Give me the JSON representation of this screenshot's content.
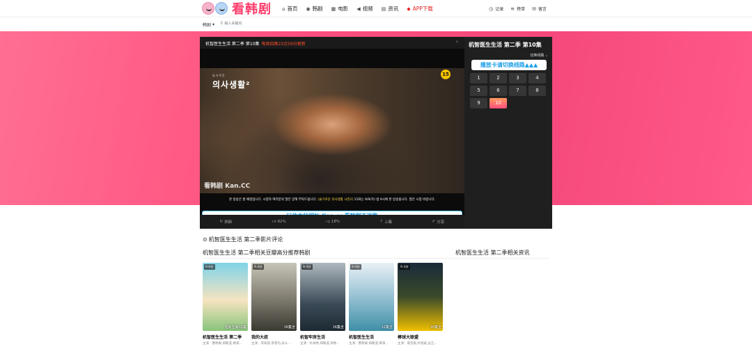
{
  "header": {
    "logo_text": "看韩剧",
    "nav": [
      {
        "label": "首页",
        "icon": "home-icon"
      },
      {
        "label": "韩剧",
        "icon": "tv-icon"
      },
      {
        "label": "电影",
        "icon": "film-icon"
      },
      {
        "label": "视频",
        "icon": "play-icon"
      },
      {
        "label": "资讯",
        "icon": "news-icon"
      },
      {
        "label": "APP下载",
        "icon": "app-icon"
      }
    ],
    "right": [
      {
        "label": "记录",
        "icon": "history-icon"
      },
      {
        "label": "榜单",
        "icon": "rank-icon"
      },
      {
        "label": "留言",
        "icon": "message-icon"
      }
    ],
    "accent": "#ff3b6b"
  },
  "search": {
    "scope": "韩剧",
    "placeholder": "输入关键词"
  },
  "player": {
    "title": "机智医生生活 第二季 第10集",
    "schedule": "每周四晚23点59分更新",
    "show_logo_small": "슬기로운",
    "show_logo": "의사생활²",
    "age_rating": "15",
    "watermark": "看韩剧 Kan.CC",
    "subtitle_pre": "본 방송은 잘 예정입니다. 시청자 여러분의 많은 양해 부탁드립니다.",
    "subtitle_bold": "[슬기로운 의사생활 시즌2]",
    "subtitle_post": "11화는 9/9(목) 밤 9시에 본 방송됩니다. 많은 시청 바랍니다.",
    "remember": "记住本站网址 Kan.cc 看韩剧不迷路",
    "actions": [
      {
        "label": "刷新",
        "icon": "refresh-icon"
      },
      {
        "label": "82%",
        "icon": "thumb-up-icon"
      },
      {
        "label": "18%",
        "icon": "thumb-down-icon"
      },
      {
        "label": "上集",
        "icon": "prev-icon"
      },
      {
        "label": "分享",
        "icon": "share-icon"
      }
    ]
  },
  "episodes": {
    "title": "机智医生生活 第二季  第10集",
    "switch_label": "切换线路",
    "line_button": "播放卡请切换线路▲▲▲",
    "list": [
      "1",
      "2",
      "3",
      "4",
      "5",
      "6",
      "7",
      "8",
      "9",
      "10"
    ],
    "active": "10"
  },
  "comments": {
    "title": "机智医生生活 第二季影片评论"
  },
  "recommend": {
    "title": "机智医生生活 第二季相关豆瓣高分推荐韩剧",
    "news_title": "机智医生生活 第二季相关资讯",
    "cards": [
      {
        "score": "9.6分",
        "status": "更新至第10集",
        "name": "机智医生生活 第二季",
        "cast": "主演：曹政奭,郑敬淏,柳演..."
      },
      {
        "score": "9.4分",
        "status": "16集全",
        "name": "我的大叔",
        "cast": "主演：李知恩,李善均,高斗..."
      },
      {
        "score": "9.4分",
        "status": "16集全",
        "name": "机智牢房生活",
        "cast": "主演：朴海秀,郑敬淏,郑秀..."
      },
      {
        "score": "9.4分",
        "status": "12集全",
        "name": "机智医生生活",
        "cast": "主演：曹政奭,郑敬淏,柳演..."
      },
      {
        "score": "9.3分",
        "status": "16集全",
        "name": "棒球大联盟",
        "cast": "主演：南宫珉,朴恩斌,吴正..."
      }
    ]
  }
}
